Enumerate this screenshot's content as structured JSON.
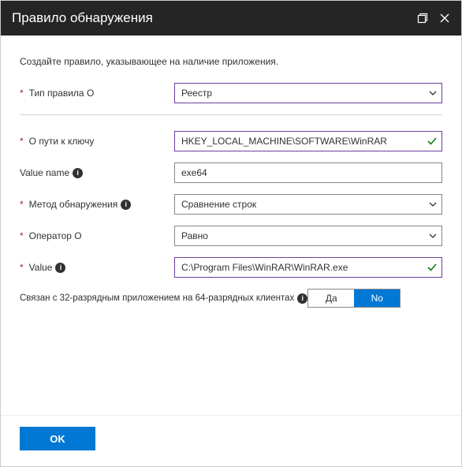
{
  "header": {
    "title": "Правило обнаружения"
  },
  "subtitle": "Создайте правило, указывающее на наличие приложения.",
  "labels": {
    "ruleType": "Тип правила О",
    "keyPath": "О пути к ключу",
    "valueName": "Value name",
    "detectionMethod": "Метод обнаружения",
    "operator": "Оператор О",
    "value": "Value",
    "associated": "Связан с 32-разрядным приложением на 64-разрядных клиентах"
  },
  "values": {
    "ruleType": "Реестр",
    "keyPath": "HKEY_LOCAL_MACHINE\\SOFTWARE\\WinRAR",
    "valueName": "exe64",
    "detectionMethod": "Сравнение строк",
    "operator": "Равно",
    "value": "C:\\Program Files\\WinRAR\\WinRAR.exe"
  },
  "toggle": {
    "yes": "Да",
    "no": "No",
    "selected": "no"
  },
  "footer": {
    "ok": "OK"
  }
}
